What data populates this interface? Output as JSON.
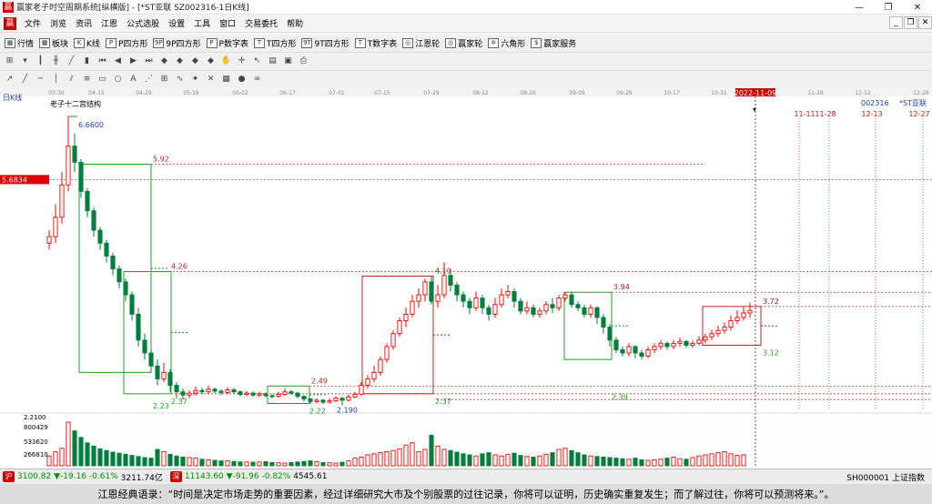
{
  "window": {
    "title": "赢家老子时空周期系统[纵横版] - [*ST亚联  SZ002316-1日K线]",
    "min": "—",
    "max": "❐",
    "close": "✕"
  },
  "menu": {
    "logo": "赢",
    "items": [
      "文件",
      "浏览",
      "资讯",
      "江恩",
      "公式选股",
      "设置",
      "工具",
      "窗口",
      "交易委托",
      "帮助"
    ],
    "mdi": [
      "_",
      "❐",
      "✕"
    ]
  },
  "toolbar": {
    "items": [
      {
        "icon": "▦",
        "label": "行情"
      },
      {
        "icon": "▦",
        "label": "板块"
      },
      {
        "icon": "K",
        "label": "K线"
      },
      {
        "icon": "P",
        "label": "P四方形"
      },
      {
        "icon": "9P",
        "label": "9P四方形"
      },
      {
        "icon": "P",
        "label": "P数字表"
      },
      {
        "icon": "T",
        "label": "T四方形"
      },
      {
        "icon": "9T",
        "label": "9T四方形"
      },
      {
        "icon": "T",
        "label": "T数字表"
      },
      {
        "icon": "◎",
        "label": "江恩轮"
      },
      {
        "icon": "◎",
        "label": "赢家轮"
      },
      {
        "icon": "✡",
        "label": "六角形"
      },
      {
        "icon": "$",
        "label": "赢家服务"
      }
    ]
  },
  "chart_data": {
    "type": "candlestick",
    "symbol_code": "002316",
    "symbol_name": "*ST亚联",
    "period_label": "日K线",
    "struct_label": "老子十二宫结构",
    "date_ticks": [
      "03-30",
      "04-15",
      "04-29",
      "05-19",
      "06-02",
      "06-17",
      "07-01",
      "07-15",
      "07-29",
      "08-12",
      "08-26",
      "09-09",
      "09-26",
      "10-17",
      "10-31",
      "2022-11-09",
      "11-28",
      "12-12",
      "12-26"
    ],
    "future_dates": [
      "11-11",
      "11-28",
      "12-13",
      "12-27"
    ],
    "current_price_label": "5.6834",
    "vol_ticks": [
      "2.2100",
      "800429",
      "533620",
      "266810"
    ],
    "price_labels": [
      "6.6600",
      "5.92",
      "4.26",
      "4.19",
      "3.94",
      "3.72",
      "2.49",
      "2.37",
      "2.37",
      "2.23",
      "2.22",
      "2.190",
      "2.39",
      "3.12"
    ],
    "ylim": [
      2.1,
      6.8
    ],
    "candles": [
      {
        "o": 4.7,
        "c": 4.8,
        "h": 4.9,
        "l": 4.6
      },
      {
        "o": 4.8,
        "c": 5.1,
        "h": 5.3,
        "l": 4.7
      },
      {
        "o": 5.1,
        "c": 5.6,
        "h": 5.8,
        "l": 5.0
      },
      {
        "o": 5.6,
        "c": 6.2,
        "h": 6.66,
        "l": 5.5
      },
      {
        "o": 6.2,
        "c": 5.95,
        "h": 6.4,
        "l": 5.8
      },
      {
        "o": 5.95,
        "c": 5.5,
        "h": 6.0,
        "l": 5.4
      },
      {
        "o": 5.5,
        "c": 5.2,
        "h": 5.55,
        "l": 5.1
      },
      {
        "o": 5.2,
        "c": 4.9,
        "h": 5.25,
        "l": 4.8
      },
      {
        "o": 4.9,
        "c": 4.7,
        "h": 4.95,
        "l": 4.6
      },
      {
        "o": 4.7,
        "c": 4.5,
        "h": 4.75,
        "l": 4.4
      },
      {
        "o": 4.5,
        "c": 4.3,
        "h": 4.55,
        "l": 4.2
      },
      {
        "o": 4.3,
        "c": 4.1,
        "h": 4.35,
        "l": 4.0
      },
      {
        "o": 4.1,
        "c": 3.9,
        "h": 4.15,
        "l": 3.8
      },
      {
        "o": 3.9,
        "c": 3.6,
        "h": 3.95,
        "l": 3.5
      },
      {
        "o": 3.6,
        "c": 3.2,
        "h": 3.7,
        "l": 3.1
      },
      {
        "o": 3.2,
        "c": 3.0,
        "h": 3.3,
        "l": 2.9
      },
      {
        "o": 3.0,
        "c": 2.8,
        "h": 3.05,
        "l": 2.7
      },
      {
        "o": 2.8,
        "c": 2.6,
        "h": 2.9,
        "l": 2.5
      },
      {
        "o": 2.6,
        "c": 2.7,
        "h": 2.85,
        "l": 2.55
      },
      {
        "o": 2.7,
        "c": 2.5,
        "h": 2.75,
        "l": 2.4
      },
      {
        "o": 2.5,
        "c": 2.4,
        "h": 2.55,
        "l": 2.3
      },
      {
        "o": 2.4,
        "c": 2.35,
        "h": 2.45,
        "l": 2.28
      },
      {
        "o": 2.35,
        "c": 2.38,
        "h": 2.42,
        "l": 2.3
      },
      {
        "o": 2.38,
        "c": 2.42,
        "h": 2.48,
        "l": 2.34
      },
      {
        "o": 2.42,
        "c": 2.4,
        "h": 2.46,
        "l": 2.36
      },
      {
        "o": 2.4,
        "c": 2.44,
        "h": 2.5,
        "l": 2.37
      },
      {
        "o": 2.44,
        "c": 2.41,
        "h": 2.47,
        "l": 2.38
      },
      {
        "o": 2.41,
        "c": 2.39,
        "h": 2.44,
        "l": 2.35
      },
      {
        "o": 2.39,
        "c": 2.43,
        "h": 2.47,
        "l": 2.36
      },
      {
        "o": 2.43,
        "c": 2.4,
        "h": 2.46,
        "l": 2.37
      },
      {
        "o": 2.4,
        "c": 2.36,
        "h": 2.42,
        "l": 2.33
      },
      {
        "o": 2.36,
        "c": 2.38,
        "h": 2.41,
        "l": 2.33
      },
      {
        "o": 2.38,
        "c": 2.35,
        "h": 2.4,
        "l": 2.32
      },
      {
        "o": 2.35,
        "c": 2.37,
        "h": 2.4,
        "l": 2.32
      },
      {
        "o": 2.37,
        "c": 2.34,
        "h": 2.39,
        "l": 2.31
      },
      {
        "o": 2.34,
        "c": 2.33,
        "h": 2.37,
        "l": 2.3
      },
      {
        "o": 2.33,
        "c": 2.36,
        "h": 2.4,
        "l": 2.31
      },
      {
        "o": 2.36,
        "c": 2.4,
        "h": 2.45,
        "l": 2.34
      },
      {
        "o": 2.4,
        "c": 2.38,
        "h": 2.43,
        "l": 2.35
      },
      {
        "o": 2.38,
        "c": 2.33,
        "h": 2.4,
        "l": 2.3
      },
      {
        "o": 2.33,
        "c": 2.29,
        "h": 2.35,
        "l": 2.25
      },
      {
        "o": 2.29,
        "c": 2.25,
        "h": 2.3,
        "l": 2.22
      },
      {
        "o": 2.25,
        "c": 2.27,
        "h": 2.3,
        "l": 2.22
      },
      {
        "o": 2.27,
        "c": 2.24,
        "h": 2.29,
        "l": 2.21
      },
      {
        "o": 2.24,
        "c": 2.26,
        "h": 2.3,
        "l": 2.22
      },
      {
        "o": 2.26,
        "c": 2.3,
        "h": 2.33,
        "l": 2.24
      },
      {
        "o": 2.3,
        "c": 2.27,
        "h": 2.32,
        "l": 2.19
      },
      {
        "o": 2.27,
        "c": 2.32,
        "h": 2.36,
        "l": 2.25
      },
      {
        "o": 2.32,
        "c": 2.36,
        "h": 2.4,
        "l": 2.3
      },
      {
        "o": 2.36,
        "c": 2.5,
        "h": 2.55,
        "l": 2.34
      },
      {
        "o": 2.5,
        "c": 2.6,
        "h": 2.66,
        "l": 2.45
      },
      {
        "o": 2.6,
        "c": 2.7,
        "h": 2.8,
        "l": 2.55
      },
      {
        "o": 2.7,
        "c": 2.9,
        "h": 2.95,
        "l": 2.65
      },
      {
        "o": 2.9,
        "c": 3.1,
        "h": 3.15,
        "l": 2.85
      },
      {
        "o": 3.1,
        "c": 3.3,
        "h": 3.35,
        "l": 3.05
      },
      {
        "o": 3.3,
        "c": 3.5,
        "h": 3.55,
        "l": 3.25
      },
      {
        "o": 3.5,
        "c": 3.6,
        "h": 3.7,
        "l": 3.4
      },
      {
        "o": 3.6,
        "c": 3.8,
        "h": 3.9,
        "l": 3.55
      },
      {
        "o": 3.8,
        "c": 3.9,
        "h": 4.0,
        "l": 3.7
      },
      {
        "o": 3.9,
        "c": 4.1,
        "h": 4.15,
        "l": 3.8
      },
      {
        "o": 4.1,
        "c": 3.8,
        "h": 4.19,
        "l": 3.75
      },
      {
        "o": 3.8,
        "c": 3.9,
        "h": 4.05,
        "l": 3.7
      },
      {
        "o": 3.9,
        "c": 4.2,
        "h": 4.4,
        "l": 3.85
      },
      {
        "o": 4.2,
        "c": 4.05,
        "h": 4.3,
        "l": 3.95
      },
      {
        "o": 4.05,
        "c": 3.9,
        "h": 4.1,
        "l": 3.8
      },
      {
        "o": 3.9,
        "c": 3.8,
        "h": 3.95,
        "l": 3.7
      },
      {
        "o": 3.8,
        "c": 3.7,
        "h": 3.85,
        "l": 3.6
      },
      {
        "o": 3.7,
        "c": 3.85,
        "h": 3.95,
        "l": 3.65
      },
      {
        "o": 3.85,
        "c": 3.7,
        "h": 3.9,
        "l": 3.6
      },
      {
        "o": 3.7,
        "c": 3.6,
        "h": 3.75,
        "l": 3.5
      },
      {
        "o": 3.6,
        "c": 3.75,
        "h": 3.85,
        "l": 3.55
      },
      {
        "o": 3.75,
        "c": 3.9,
        "h": 4.0,
        "l": 3.7
      },
      {
        "o": 3.9,
        "c": 3.95,
        "h": 4.05,
        "l": 3.85
      },
      {
        "o": 3.95,
        "c": 3.8,
        "h": 4.0,
        "l": 3.7
      },
      {
        "o": 3.8,
        "c": 3.65,
        "h": 3.85,
        "l": 3.6
      },
      {
        "o": 3.65,
        "c": 3.7,
        "h": 3.8,
        "l": 3.6
      },
      {
        "o": 3.7,
        "c": 3.6,
        "h": 3.75,
        "l": 3.55
      },
      {
        "o": 3.6,
        "c": 3.65,
        "h": 3.7,
        "l": 3.55
      },
      {
        "o": 3.65,
        "c": 3.75,
        "h": 3.8,
        "l": 3.6
      },
      {
        "o": 3.75,
        "c": 3.7,
        "h": 3.85,
        "l": 3.62
      },
      {
        "o": 3.7,
        "c": 3.85,
        "h": 3.9,
        "l": 3.65
      },
      {
        "o": 3.85,
        "c": 3.9,
        "h": 3.94,
        "l": 3.8
      },
      {
        "o": 3.9,
        "c": 3.75,
        "h": 3.95,
        "l": 3.7
      },
      {
        "o": 3.75,
        "c": 3.7,
        "h": 3.8,
        "l": 3.65
      },
      {
        "o": 3.7,
        "c": 3.6,
        "h": 3.75,
        "l": 3.55
      },
      {
        "o": 3.6,
        "c": 3.7,
        "h": 3.75,
        "l": 3.55
      },
      {
        "o": 3.7,
        "c": 3.55,
        "h": 3.72,
        "l": 3.45
      },
      {
        "o": 3.55,
        "c": 3.4,
        "h": 3.6,
        "l": 3.3
      },
      {
        "o": 3.4,
        "c": 3.2,
        "h": 3.45,
        "l": 3.1
      },
      {
        "o": 3.2,
        "c": 3.05,
        "h": 3.25,
        "l": 3.0
      },
      {
        "o": 3.05,
        "c": 3.0,
        "h": 3.1,
        "l": 2.95
      },
      {
        "o": 3.0,
        "c": 3.1,
        "h": 3.15,
        "l": 2.95
      },
      {
        "o": 3.1,
        "c": 3.0,
        "h": 3.12,
        "l": 2.92
      },
      {
        "o": 3.0,
        "c": 2.95,
        "h": 3.05,
        "l": 2.9
      },
      {
        "o": 2.95,
        "c": 3.05,
        "h": 3.1,
        "l": 2.92
      },
      {
        "o": 3.05,
        "c": 3.1,
        "h": 3.15,
        "l": 3.0
      },
      {
        "o": 3.1,
        "c": 3.15,
        "h": 3.2,
        "l": 3.05
      },
      {
        "o": 3.15,
        "c": 3.1,
        "h": 3.18,
        "l": 3.05
      },
      {
        "o": 3.1,
        "c": 3.15,
        "h": 3.2,
        "l": 3.06
      },
      {
        "o": 3.15,
        "c": 3.18,
        "h": 3.24,
        "l": 3.1
      },
      {
        "o": 3.18,
        "c": 3.12,
        "h": 3.2,
        "l": 3.08
      },
      {
        "o": 3.12,
        "c": 3.15,
        "h": 3.19,
        "l": 3.08
      },
      {
        "o": 3.15,
        "c": 3.2,
        "h": 3.26,
        "l": 3.12
      },
      {
        "o": 3.2,
        "c": 3.25,
        "h": 3.3,
        "l": 3.15
      },
      {
        "o": 3.25,
        "c": 3.3,
        "h": 3.36,
        "l": 3.2
      },
      {
        "o": 3.3,
        "c": 3.35,
        "h": 3.42,
        "l": 3.25
      },
      {
        "o": 3.35,
        "c": 3.4,
        "h": 3.47,
        "l": 3.3
      },
      {
        "o": 3.4,
        "c": 3.5,
        "h": 3.58,
        "l": 3.35
      },
      {
        "o": 3.5,
        "c": 3.55,
        "h": 3.66,
        "l": 3.45
      },
      {
        "o": 3.55,
        "c": 3.62,
        "h": 3.72,
        "l": 3.5
      },
      {
        "o": 3.62,
        "c": 3.66,
        "h": 3.78,
        "l": 3.55
      }
    ],
    "volumes": [
      180,
      260,
      320,
      800,
      640,
      520,
      420,
      360,
      310,
      280,
      250,
      230,
      210,
      190,
      170,
      150,
      140,
      300,
      260,
      210,
      180,
      160,
      150,
      140,
      120,
      110,
      100,
      90,
      90,
      80,
      70,
      70,
      65,
      70,
      75,
      60,
      55,
      50,
      60,
      70,
      80,
      90,
      75,
      60,
      55,
      50,
      65,
      90,
      140,
      160,
      200,
      220,
      240,
      260,
      280,
      310,
      380,
      420,
      260,
      300,
      560,
      360,
      300,
      280,
      250,
      220,
      200,
      180,
      220,
      240,
      200,
      180,
      210,
      230,
      190,
      170,
      160,
      180,
      210,
      240,
      300,
      320,
      280,
      240,
      200,
      180,
      170,
      160,
      150,
      140,
      130,
      120,
      140,
      110,
      100,
      110,
      120,
      140,
      160,
      130,
      120,
      150,
      180,
      200,
      220,
      240,
      260,
      220,
      190,
      200
    ],
    "vol_max": 900
  },
  "status": {
    "idx1": "3100.82",
    "idx1_chg": "▼-19.16",
    "idx1_pct": "-0.61%",
    "idx1_amt": "3211.74亿",
    "idx2": "11143.60",
    "idx2_chg": "▼-91.96",
    "idx2_pct": "-0.82%",
    "idx2_amt": "4545.61",
    "right": "SH000001 上证指数",
    "icon1": "沪",
    "icon2": "深"
  },
  "quote": "江恩经典语录：“时间是决定市场走势的重要因素，经过详细研究大市及个别股票的过往记录，你将可以证明，历史确实重复发生；而了解过往，你将可以预测将来。”。",
  "colors": {
    "up": "#ff0000",
    "down": "#007f3c",
    "box_green": "#1fa01f",
    "box_red": "#c02020",
    "dash_red": "#e03030"
  }
}
